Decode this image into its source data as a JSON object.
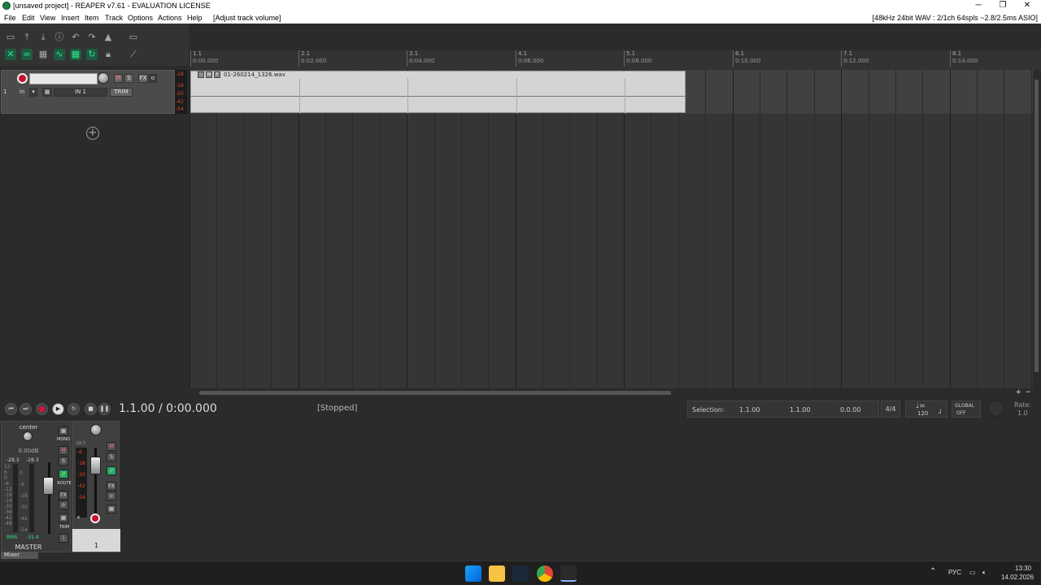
{
  "window": {
    "title": "[unsaved project] - REAPER v7.61 - EVALUATION LICENSE",
    "minimize": "─",
    "maximize": "❐",
    "close": "✕"
  },
  "menu": {
    "items": [
      "File",
      "Edit",
      "View",
      "Insert",
      "Item",
      "Track",
      "Options",
      "Actions",
      "Help"
    ],
    "undo_hint": "[Adjust track volume]",
    "audio_info": "[48kHz 24bit WAV : 2/1ch 64spls ~2.8/2.5ms ASIO]"
  },
  "ruler": {
    "ticks": [
      {
        "bar": "1.1",
        "time": "0:00.000"
      },
      {
        "bar": "2.1",
        "time": "0:02.000"
      },
      {
        "bar": "3.1",
        "time": "0:04.000"
      },
      {
        "bar": "4.1",
        "time": "0:06.000"
      },
      {
        "bar": "5.1",
        "time": "0:08.000"
      },
      {
        "bar": "6.1",
        "time": "0:10.000"
      },
      {
        "bar": "7.1",
        "time": "0:12.000"
      },
      {
        "bar": "8.1",
        "time": "0:14.000"
      }
    ]
  },
  "track": {
    "number": "1",
    "input_label": "in",
    "input_name": "IN 1",
    "trim": "TRIM",
    "mute": "M",
    "solo": "S",
    "fx": "FX",
    "meter_scale": [
      "-28",
      "-18",
      "-20",
      "-42",
      "-54"
    ]
  },
  "media_item": {
    "filename": "01-260214_1326.wav"
  },
  "transport": {
    "time": "1.1.00 / 0:00.000",
    "status": "[Stopped]",
    "selection_label": "Selection:",
    "sel_start": "1.1.00",
    "sel_end": "1.1.00",
    "sel_length": "0.0.00",
    "time_sig": "4/4",
    "bpm": "120",
    "global_label": "GLOBAL",
    "global_value": "OFF",
    "rate_label": "Rate:",
    "rate_value": "1.0"
  },
  "mixer": {
    "master": {
      "pan": "center",
      "volume": "0.00dB",
      "peak_l": "-28.3",
      "peak_r": "-28.3",
      "rms_label": "RMS",
      "rms_value": "-31.4",
      "name": "MASTER",
      "mono": "MONO",
      "route": "ROUTE",
      "trim": "TRIM",
      "info": "i",
      "scale_l": [
        "12",
        "6",
        "0",
        "-6",
        "-12",
        "-18",
        "-24",
        "-30",
        "-36",
        "-42",
        "-48"
      ],
      "scale_r": [
        "0",
        "-6",
        "-18",
        "-30",
        "-42",
        "-54"
      ]
    },
    "track": {
      "peak": "-28.3",
      "scale": [
        "-6",
        "-18",
        "-30",
        "-42",
        "-54"
      ],
      "number": "1"
    },
    "tab_label": "Mixer"
  },
  "taskbar": {
    "lang": "РУС",
    "time": "13:30",
    "date": "14.02.2026"
  },
  "colors": {
    "record_red": "#c8102e",
    "meter_orange": "#e0461f",
    "accent_green": "#2fe58a"
  }
}
